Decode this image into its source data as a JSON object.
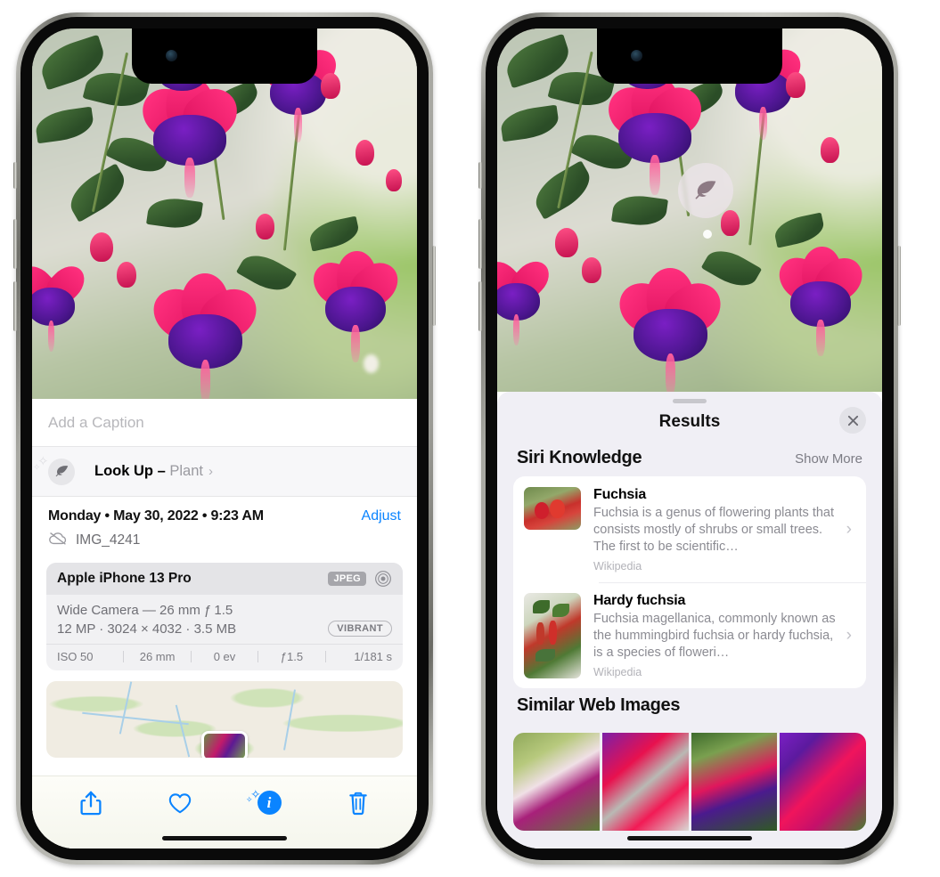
{
  "left_phone": {
    "caption": {
      "placeholder": "Add a Caption",
      "value": ""
    },
    "lookup": {
      "label": "Look Up – ",
      "subject": "Plant",
      "chevron": "›",
      "icon": "leaf-icon"
    },
    "date_line": "Monday • May 30, 2022 • 9:23 AM",
    "adjust_label": "Adjust",
    "filename": "IMG_4241",
    "filename_icon": "cloud-slash-icon",
    "metadata": {
      "device": "Apple iPhone 13 Pro",
      "format_badge": "JPEG",
      "lens_icon": "camera-lens-icon",
      "camera_line": "Wide Camera — 26 mm ƒ 1.5",
      "size_line": "12 MP · 3024 × 4032 · 3.5 MB",
      "style_badge": "VIBRANT",
      "exif": [
        "ISO 50",
        "26 mm",
        "0 ev",
        "ƒ1.5",
        "1/181 s"
      ]
    },
    "toolbar": [
      {
        "name": "share-button",
        "icon": "share-icon"
      },
      {
        "name": "favorite-button",
        "icon": "heart-icon"
      },
      {
        "name": "info-button",
        "icon": "info-sparkle-icon",
        "glyph": "i"
      },
      {
        "name": "delete-button",
        "icon": "trash-icon"
      }
    ]
  },
  "right_phone": {
    "photo_badge": {
      "icon": "leaf-icon",
      "name": "visual-lookup-badge"
    },
    "sheet": {
      "title": "Results",
      "close_icon": "close-icon",
      "siri_knowledge": {
        "title": "Siri Knowledge",
        "action": "Show More",
        "cards": [
          {
            "title": "Fuchsia",
            "description": "Fuchsia is a genus of flowering plants that consists mostly of shrubs or small trees. The first to be scientific…",
            "source": "Wikipedia",
            "chevron": "›"
          },
          {
            "title": "Hardy fuchsia",
            "description": "Fuchsia magellanica, commonly known as the hummingbird fuchsia or hardy fuchsia, is a species of floweri…",
            "source": "Wikipedia",
            "chevron": "›"
          }
        ]
      },
      "similar_web_images": {
        "title": "Similar Web Images",
        "count": 4
      }
    }
  },
  "colors": {
    "accent_blue": "#0a84ff",
    "sheet_background": "#f0eff5",
    "card_background": "#ffffff",
    "secondary_text": "#8b8b92",
    "meta_card": "#f1f1f3",
    "meta_header": "#e4e4e7"
  }
}
